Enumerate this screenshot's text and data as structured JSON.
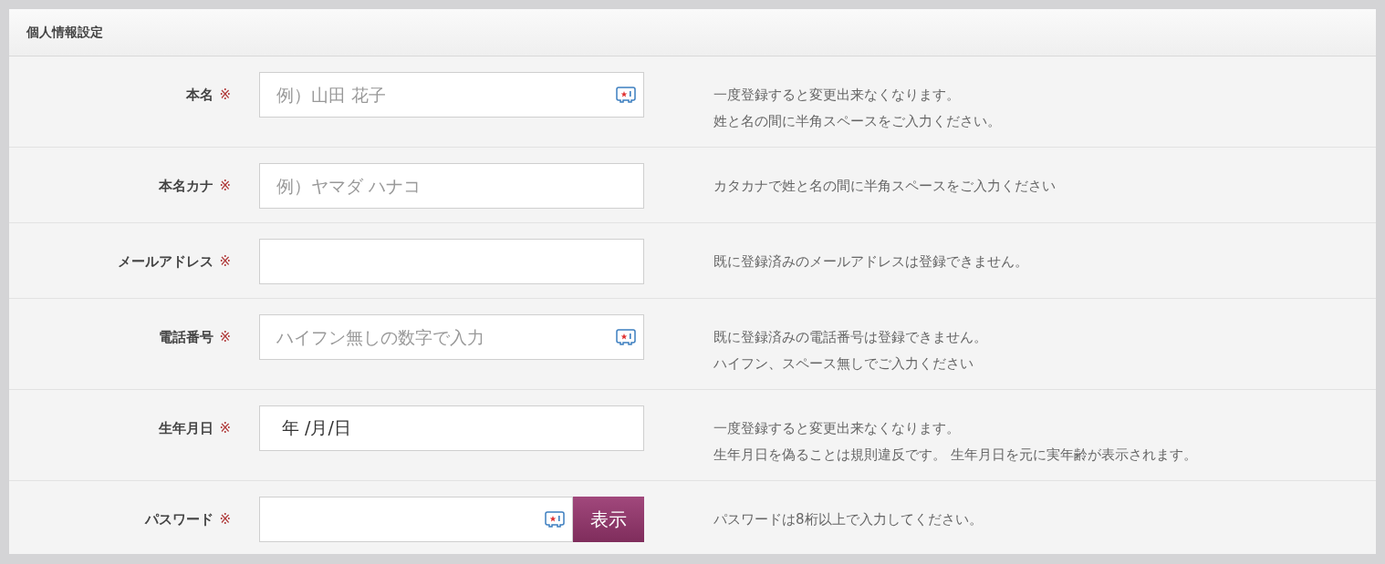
{
  "panel": {
    "title": "個人情報設定"
  },
  "rows": [
    {
      "label": "本名",
      "required_mark": "※",
      "placeholder": "例）山田 花子",
      "key_icon": true,
      "notes": [
        "一度登録すると変更出来なくなります。",
        "姓と名の間に半角スペースをご入力ください。"
      ]
    },
    {
      "label": "本名カナ",
      "required_mark": "※",
      "placeholder": "例）ヤマダ ハナコ",
      "key_icon": false,
      "notes": [
        "カタカナで姓と名の間に半角スペースをご入力ください"
      ]
    },
    {
      "label": "メールアドレス",
      "required_mark": "※",
      "key_icon": false,
      "notes": [
        "既に登録済みのメールアドレスは登録できません。"
      ]
    },
    {
      "label": "電話番号",
      "required_mark": "※",
      "placeholder": "ハイフン無しの数字で入力",
      "key_icon": true,
      "notes": [
        "既に登録済みの電話番号は登録できません。",
        "ハイフン、スペース無しでご入力ください"
      ]
    },
    {
      "label": "生年月日",
      "required_mark": "※",
      "value": " 年 /月/日",
      "key_icon": false,
      "notes": [
        "一度登録すると変更出来なくなります。",
        "生年月日を偽ることは規則違反です。 生年月日を元に実年齢が表示されます。"
      ]
    },
    {
      "label": "パスワード",
      "required_mark": "※",
      "key_icon": true,
      "button": "表示",
      "notes": [
        "パスワードは8桁以上で入力してください。"
      ]
    }
  ]
}
